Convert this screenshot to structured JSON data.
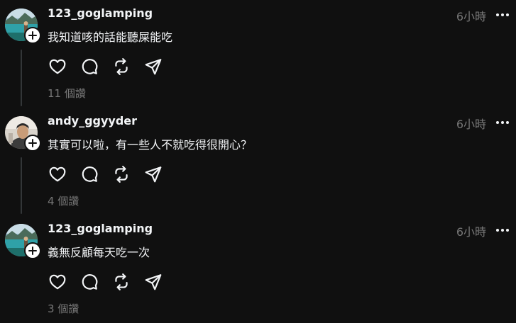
{
  "comments": [
    {
      "username": "123_goglamping",
      "time": "6小時",
      "text": "我知道咳的話能聽屎能吃",
      "likes": "11 個讚",
      "avatar": "landscape-lake-avatar"
    },
    {
      "username": "andy_ggyyder",
      "time": "6小時",
      "text": "其實可以啦，有一些人不就吃得很開心？",
      "likes": "4 個讚",
      "avatar": "person-avatar"
    },
    {
      "username": "123_goglamping",
      "time": "6小時",
      "text": "義無反顧每天吃一次",
      "likes": "3 個讚",
      "avatar": "landscape-lake-avatar"
    }
  ],
  "icons": {
    "like": "heart-icon",
    "reply": "comment-bubble-icon",
    "repost": "repost-icon",
    "share": "send-icon",
    "follow": "plus-icon",
    "more": "more-horizontal-icon"
  },
  "colors": {
    "background": "#101010",
    "primary_text": "#f3f5f7",
    "secondary_text": "#777777",
    "thread_line": "#333638"
  }
}
